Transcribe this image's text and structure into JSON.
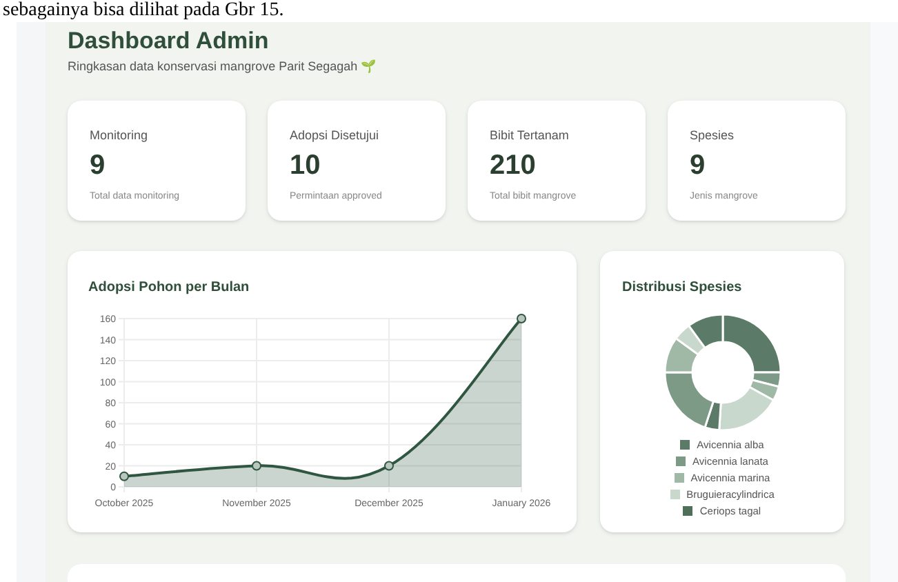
{
  "document_text": "sebagainya bisa dilihat pada Gbr 15.",
  "header": {
    "title": "Dashboard Admin",
    "subtitle": "Ringkasan data konservasi mangrove Parit Segagah 🌱"
  },
  "stats": [
    {
      "label": "Monitoring",
      "value": "9",
      "caption": "Total data monitoring"
    },
    {
      "label": "Adopsi Disetujui",
      "value": "10",
      "caption": "Permintaan approved"
    },
    {
      "label": "Bibit Tertanam",
      "value": "210",
      "caption": "Total bibit mangrove"
    },
    {
      "label": "Spesies",
      "value": "9",
      "caption": "Jenis mangrove"
    }
  ],
  "adoption_chart": {
    "title": "Adopsi Pohon per Bulan",
    "chart_data": {
      "type": "area",
      "categories": [
        "October 2025",
        "November 2025",
        "December 2025",
        "January 2026"
      ],
      "series": [
        {
          "color": "#2f5640",
          "values": [
            10,
            20,
            20,
            160
          ]
        }
      ],
      "grid": true,
      "ylim": [
        0,
        160
      ],
      "yticks": [
        0,
        20,
        40,
        60,
        80,
        100,
        120,
        140,
        160
      ]
    }
  },
  "species_chart": {
    "title": "Distribusi Spesies",
    "legend": [
      {
        "label": "Avicennia alba",
        "color": "#5b7a67"
      },
      {
        "label": "Avicennia lanata",
        "color": "#7c9a86"
      },
      {
        "label": "Avicennia marina",
        "color": "#a0b8a6"
      },
      {
        "label": "Bruguieracylindrica",
        "color": "#c9d8cd"
      },
      {
        "label": "Ceriops tagal",
        "color": "#4f6f5b"
      }
    ]
  }
}
